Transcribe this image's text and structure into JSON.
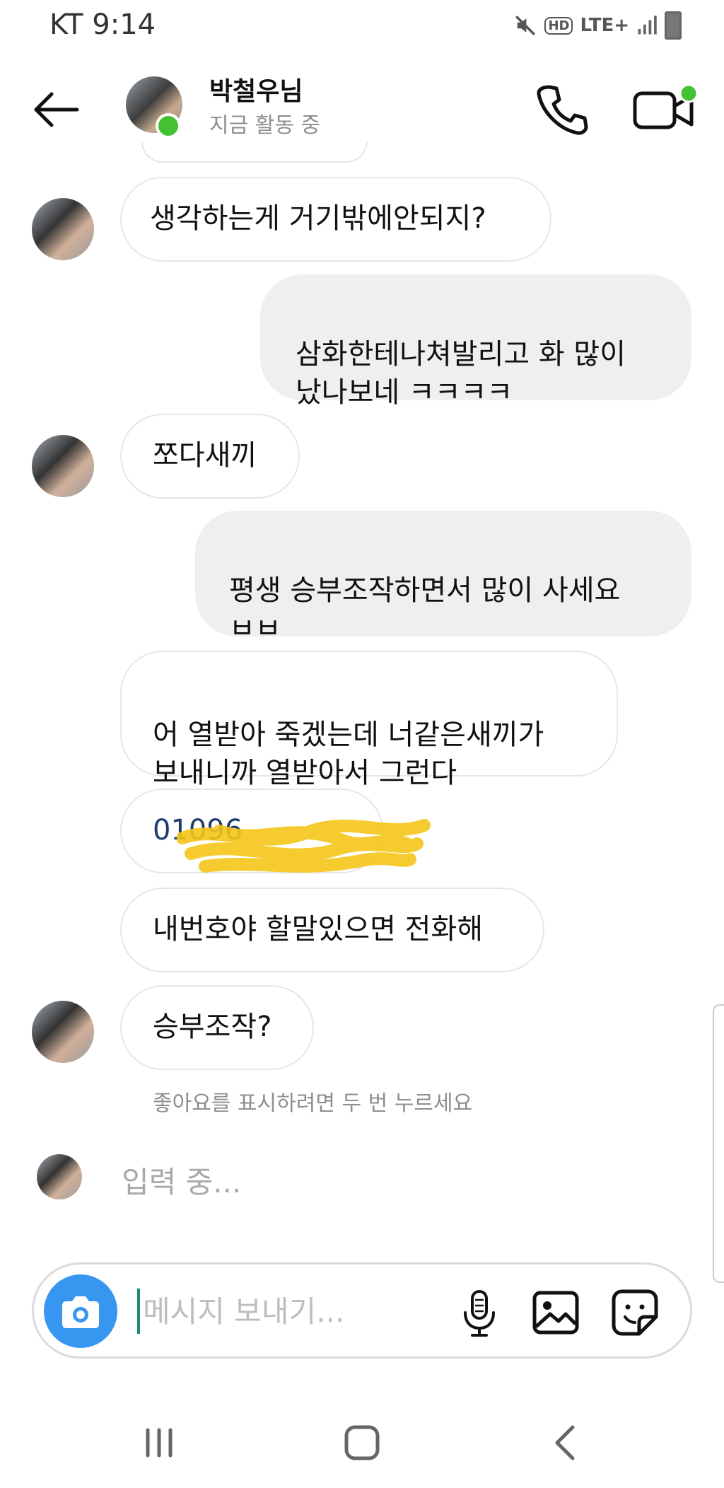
{
  "status_bar": {
    "time": "KT 9:14",
    "network": "LTE+",
    "hd": "HD"
  },
  "header": {
    "name": "박철우님",
    "status": "지금 활동 중"
  },
  "messages": [
    {
      "side": "in",
      "text": "생각하는게 거기밖에안되지?"
    },
    {
      "side": "out",
      "text": "삼화한테나쳐발리고 화 많이\n났나보네 ㅋㅋㅋㅋ"
    },
    {
      "side": "in",
      "text": "쪼다새끼"
    },
    {
      "side": "out",
      "text": "평생 승부조작하면서 많이 사세요\nㅂㅂ"
    },
    {
      "side": "in",
      "text": "어 열받아 죽겠는데 너같은새끼가\n보내니까 열받아서 그런다"
    },
    {
      "side": "in",
      "text": "01096"
    },
    {
      "side": "in",
      "text": "내번호야 할말있으면 전화해"
    },
    {
      "side": "in",
      "text": "승부조작?"
    }
  ],
  "like_hint": "좋아요를 표시하려면 두 번 누르세요",
  "typing_indicator": "입력 중...",
  "composer": {
    "placeholder": "메시지 보내기..."
  },
  "colors": {
    "accent": "#3797f0",
    "online": "#44c133",
    "outgoing_bubble": "#efefef",
    "redaction": "#f5c518"
  },
  "icons": [
    "back-arrow-icon",
    "phone-icon",
    "video-camera-icon",
    "camera-icon",
    "microphone-icon",
    "gallery-icon",
    "sticker-icon",
    "recent-apps-icon",
    "home-icon",
    "back-icon"
  ]
}
